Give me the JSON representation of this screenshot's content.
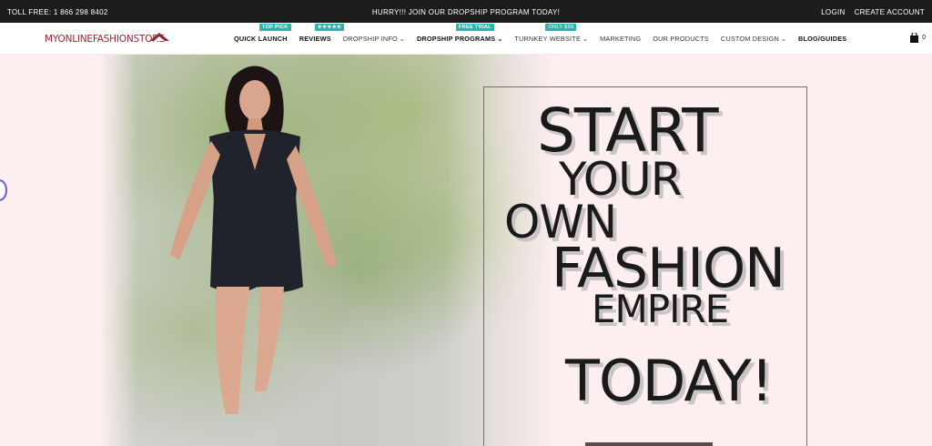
{
  "topbar": {
    "toll_free": "TOLL FREE: 1 866 298 8402",
    "promo": "HURRY!!! JOIN OUR DROPSHIP PROGRAM TODAY!",
    "login": "LOGIN",
    "create_account": "CREATE ACCOUNT"
  },
  "header": {
    "logo_text": "MYONLINEFASHIONSTORE",
    "cart_count": "0"
  },
  "nav": {
    "items": [
      {
        "label": "QUICK LAUNCH",
        "badge": "TOP PICK"
      },
      {
        "label": "REVIEWS",
        "badge": "★★★★★"
      },
      {
        "label": "DROPSHIP INFO"
      },
      {
        "label": "DROPSHIP PROGRAMS",
        "badge": "FREE TRIAL"
      },
      {
        "label": "TURNKEY WEBSITE",
        "badge": "ONLY $99"
      },
      {
        "label": "MARKETING"
      },
      {
        "label": "OUR PRODUCTS"
      },
      {
        "label": "CUSTOM DESIGN"
      },
      {
        "label": "BLOG/GUIDES"
      }
    ]
  },
  "hero": {
    "line1": "START",
    "line2": "YOUR",
    "line3": "OWN",
    "line4": "FASHION",
    "line5": "EMPIRE",
    "line6": "TODAY!"
  },
  "colors": {
    "topbar_bg": "#1c1c1c",
    "brand": "#8b2b36",
    "badge": "#2bb3b0",
    "hero_bg": "#fdeef0"
  },
  "icons": {
    "cart": "shopping-bag-icon",
    "chevron": "chevron-down-icon",
    "logo_mark": "roof-icon"
  }
}
